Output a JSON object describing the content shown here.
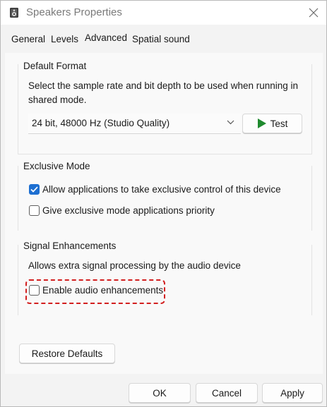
{
  "window": {
    "title": "Speakers Properties"
  },
  "tabs": [
    {
      "label": "General",
      "active": false
    },
    {
      "label": "Levels",
      "active": false
    },
    {
      "label": "Advanced",
      "active": true
    },
    {
      "label": "Spatial sound",
      "active": false
    }
  ],
  "default_format": {
    "heading": "Default Format",
    "description": "Select the sample rate and bit depth to be used when running in shared mode.",
    "selected_format": "24 bit, 48000 Hz (Studio Quality)",
    "test_label": "Test"
  },
  "exclusive_mode": {
    "heading": "Exclusive Mode",
    "allow_control_label": "Allow applications to take exclusive control of this device",
    "allow_control_checked": true,
    "priority_label": "Give exclusive mode applications priority",
    "priority_checked": false
  },
  "signal_enhancements": {
    "heading": "Signal Enhancements",
    "description": "Allows extra signal processing by the audio device",
    "enable_label": "Enable audio enhancements",
    "enable_checked": false
  },
  "restore_defaults_label": "Restore Defaults",
  "footer": {
    "ok_label": "OK",
    "cancel_label": "Cancel",
    "apply_label": "Apply"
  },
  "colors": {
    "accent": "#1d6fd1",
    "highlight": "#d21f1f",
    "play_icon": "#1f8a2e"
  },
  "icons": {
    "app": "speaker-icon",
    "close": "close-icon",
    "dropdown": "chevron-down-icon",
    "test": "play-icon",
    "checkbox_checked": "checkmark-icon"
  }
}
